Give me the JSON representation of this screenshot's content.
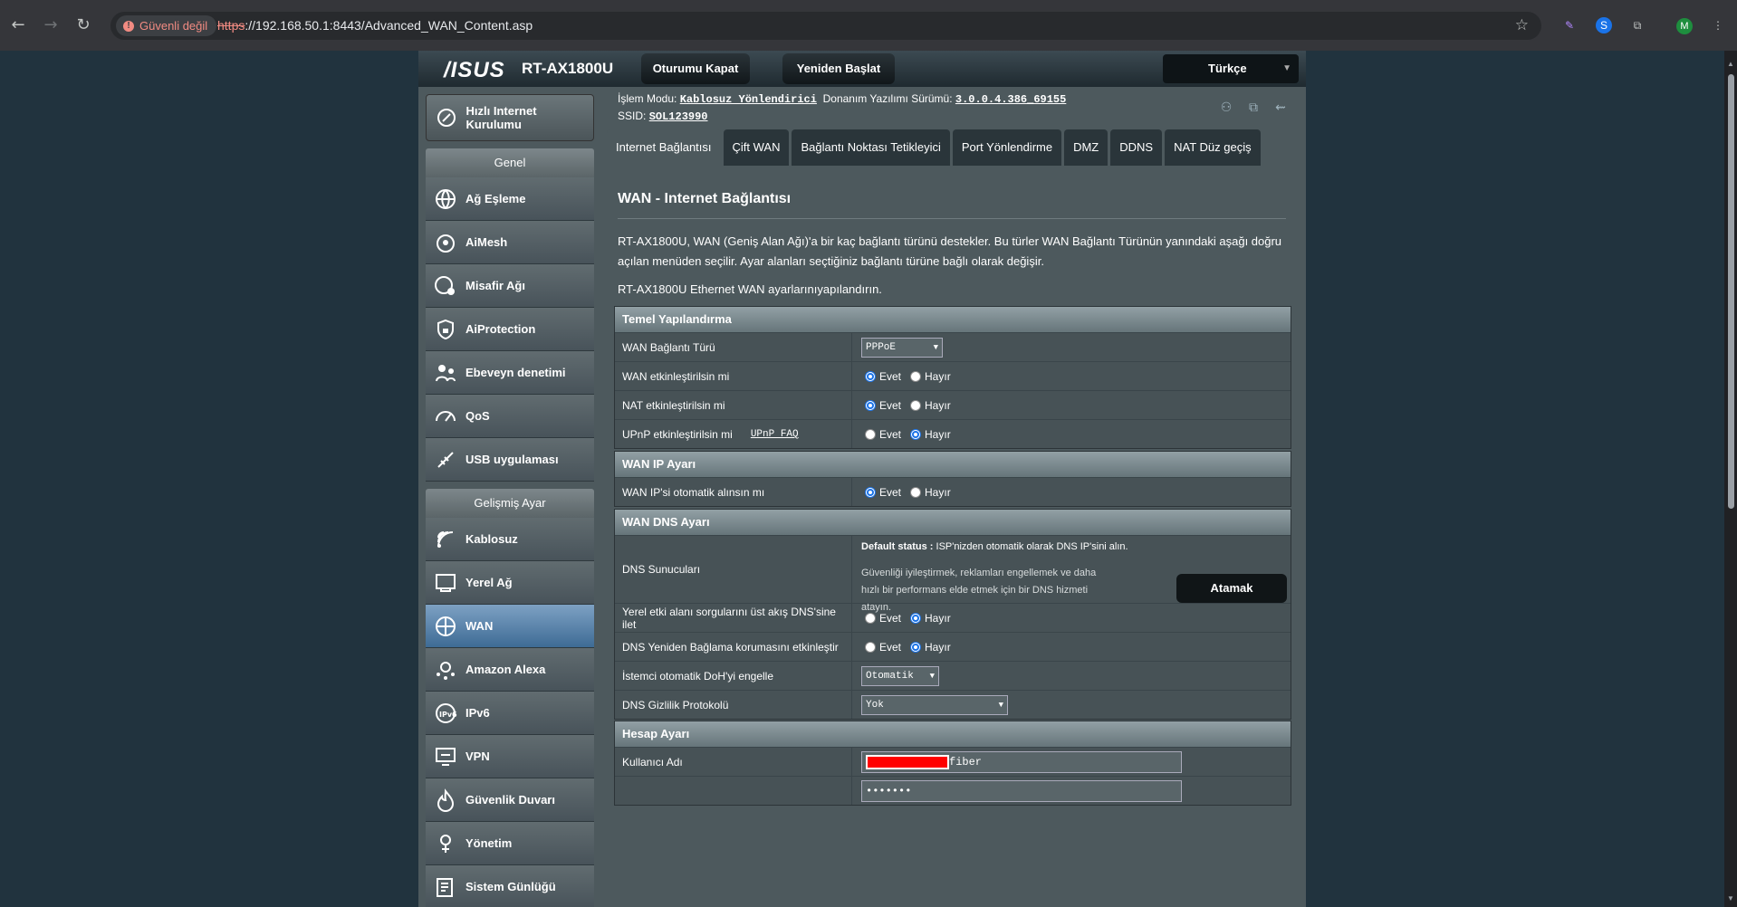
{
  "browser": {
    "security_label": "Güvenli değil",
    "url_scheme": "https",
    "url_rest": "://192.168.50.1:8443/Advanced_WAN_Content.asp",
    "profile_initial": "M"
  },
  "router": {
    "brand": "/ISUS",
    "model": "RT-AX1800U",
    "logout": "Oturumu Kapat",
    "reboot": "Yeniden Başlat",
    "language": "Türkçe",
    "op_mode_label": "İşlem Modu:",
    "op_mode_value": "Kablosuz Yönlendirici",
    "fw_label": "Donanım Yazılımı Sürümü:",
    "fw_value": "3.0.0.4.386_69155",
    "ssid_label": "SSID:",
    "ssid_value": "SOL123990"
  },
  "sidebar": {
    "qis": "Hızlı Internet Kurulumu",
    "general_head": "Genel",
    "general": [
      {
        "label": "Ağ Eşleme",
        "icon": "network-map-icon"
      },
      {
        "label": "AiMesh",
        "icon": "aimesh-icon"
      },
      {
        "label": "Misafir Ağı",
        "icon": "guest-network-icon"
      },
      {
        "label": "AiProtection",
        "icon": "aiprotection-icon"
      },
      {
        "label": "Ebeveyn denetimi",
        "icon": "parental-control-icon"
      },
      {
        "label": "QoS",
        "icon": "qos-icon"
      },
      {
        "label": "USB uygulaması",
        "icon": "usb-app-icon"
      }
    ],
    "advanced_head": "Gelişmiş Ayar",
    "advanced": [
      {
        "label": "Kablosuz",
        "icon": "wireless-icon"
      },
      {
        "label": "Yerel Ağ",
        "icon": "lan-icon"
      },
      {
        "label": "WAN",
        "icon": "wan-icon"
      },
      {
        "label": "Amazon Alexa",
        "icon": "alexa-icon"
      },
      {
        "label": "IPv6",
        "icon": "ipv6-icon"
      },
      {
        "label": "VPN",
        "icon": "vpn-icon"
      },
      {
        "label": "Güvenlik Duvarı",
        "icon": "firewall-icon"
      },
      {
        "label": "Yönetim",
        "icon": "administration-icon"
      },
      {
        "label": "Sistem Günlüğü",
        "icon": "system-log-icon"
      }
    ]
  },
  "tabs": [
    "Internet Bağlantısı",
    "Çift WAN",
    "Bağlantı Noktası Tetikleyici",
    "Port Yönlendirme",
    "DMZ",
    "DDNS",
    "NAT Düz geçiş"
  ],
  "content": {
    "title": "WAN - Internet Bağlantısı",
    "desc": "RT-AX1800U, WAN (Geniş Alan Ağı)'a bir kaç bağlantı türünü destekler. Bu türler WAN Bağlantı Türünün yanındaki aşağı doğru açılan menüden seçilir. Ayar alanları seçtiğiniz bağlantı türüne bağlı olarak değişir.",
    "desc2": "RT-AX1800U Ethernet WAN ayarlarınıyapılandırın.",
    "basic_head": "Temel Yapılandırma",
    "wan_type_label": "WAN Bağlantı Türü",
    "wan_type_value": "PPPoE",
    "wan_enable_label": "WAN etkinleştirilsin mi",
    "nat_enable_label": "NAT etkinleştirilsin mi",
    "upnp_label": "UPnP etkinleştirilsin mi",
    "upnp_faq": "UPnP  FAQ",
    "yes": "Evet",
    "no": "Hayır",
    "ip_head": "WAN IP Ayarı",
    "ip_auto_label": "WAN IP'si otomatik alınsın mı",
    "dns_head": "WAN DNS Ayarı",
    "dns_servers_label": "DNS Sunucuları",
    "dns_status_bold": "Default status :",
    "dns_status_text": " ISP'nizden otomatik olarak DNS IP'sini alın.",
    "dns_hint": "Güvenliği iyileştirmek, reklamları engellemek ve daha hızlı bir performans elde etmek için bir DNS hizmeti atayın.",
    "assign_btn": "Atamak",
    "forward_label": "Yerel etki alanı sorgularını üst akış DNS'sine ilet",
    "rebind_label": "DNS Yeniden Bağlama korumasını etkinleştir",
    "doh_label": "İstemci otomatik DoH'yi engelle",
    "doh_value": "Otomatik",
    "privacy_label": "DNS Gizlilik Protokolü",
    "privacy_value": "Yok",
    "account_head": "Hesap Ayarı",
    "username_label": "Kullanıcı Adı",
    "username_value": "fiber",
    "password_value": "•••••••"
  }
}
